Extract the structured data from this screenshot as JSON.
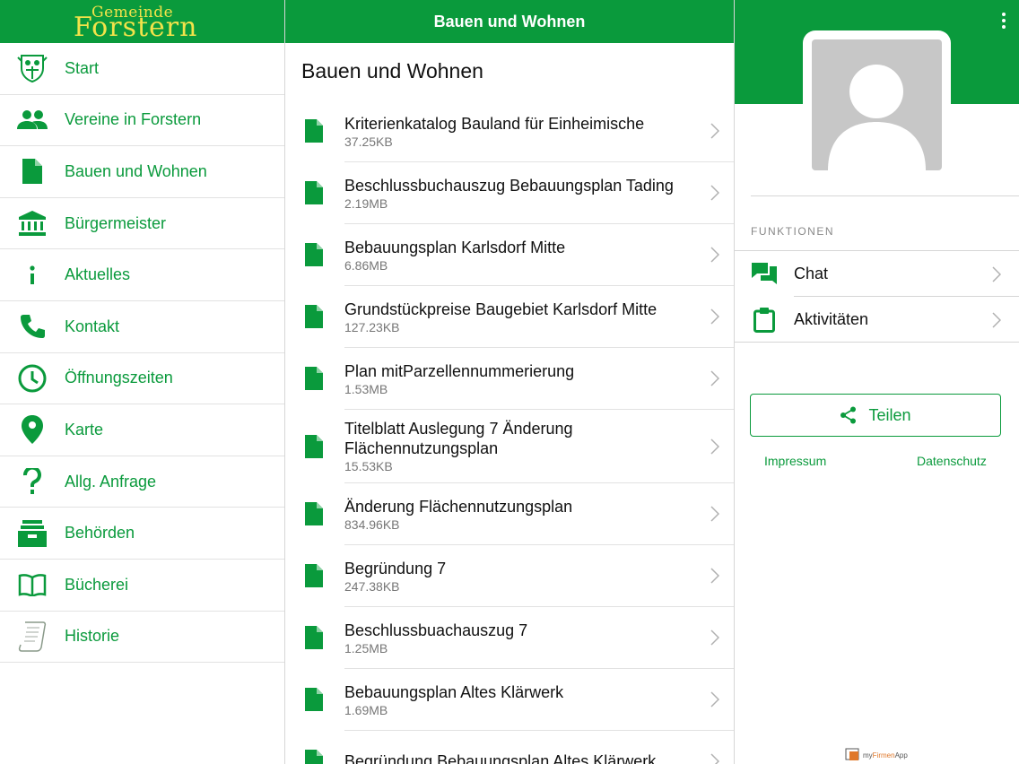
{
  "sidebar": {
    "logo": {
      "line1": "Gemeinde",
      "line2": "Forstern"
    },
    "items": [
      {
        "label": "Start",
        "icon": "crest-icon"
      },
      {
        "label": "Vereine in Forstern",
        "icon": "people-icon"
      },
      {
        "label": "Bauen und Wohnen",
        "icon": "document-icon"
      },
      {
        "label": "Bürgermeister",
        "icon": "bank-icon"
      },
      {
        "label": "Aktuelles",
        "icon": "info-icon"
      },
      {
        "label": "Kontakt",
        "icon": "phone-icon"
      },
      {
        "label": "Öffnungszeiten",
        "icon": "clock-icon"
      },
      {
        "label": "Karte",
        "icon": "map-pin-icon"
      },
      {
        "label": "Allg. Anfrage",
        "icon": "question-icon"
      },
      {
        "label": "Behörden",
        "icon": "inbox-icon"
      },
      {
        "label": "Bücherei",
        "icon": "book-icon"
      },
      {
        "label": "Historie",
        "icon": "scroll-icon"
      }
    ]
  },
  "main": {
    "header_title": "Bauen und Wohnen",
    "page_title": "Bauen und Wohnen",
    "documents": [
      {
        "title": "Kriterienkatalog Bauland für Einheimische",
        "size": "37.25KB"
      },
      {
        "title": "Beschlussbuchauszug Bebauungsplan Tading",
        "size": "2.19MB"
      },
      {
        "title": "Bebauungsplan Karlsdorf Mitte",
        "size": "6.86MB"
      },
      {
        "title": "Grundstückpreise Baugebiet Karlsdorf Mitte",
        "size": "127.23KB"
      },
      {
        "title": "Plan mitParzellennummerierung",
        "size": "1.53MB"
      },
      {
        "title": "Titelblatt Auslegung 7 Änderung Flächennutzungsplan",
        "size": "15.53KB"
      },
      {
        "title": "Änderung Flächennutzungsplan",
        "size": "834.96KB"
      },
      {
        "title": "Begründung 7",
        "size": "247.38KB"
      },
      {
        "title": "Beschlussbuachauszug 7",
        "size": "1.25MB"
      },
      {
        "title": "Bebauungsplan Altes Klärwerk",
        "size": "1.69MB"
      },
      {
        "title": "Begründung Bebauungsplan Altes Klärwerk",
        "size": ""
      }
    ]
  },
  "panel": {
    "functions_label": "FUNKTIONEN",
    "functions": [
      {
        "label": "Chat",
        "icon": "chat-icon"
      },
      {
        "label": "Aktivitäten",
        "icon": "clipboard-icon"
      }
    ],
    "share_label": "Teilen",
    "impressum": "Impressum",
    "datenschutz": "Datenschutz",
    "brand_prefix": "my",
    "brand_mid": "Firmen",
    "brand_suffix": "App"
  },
  "colors": {
    "primary": "#0a9a3c",
    "logo": "#f2e34a",
    "avatar_bg": "#c7c7c7"
  }
}
